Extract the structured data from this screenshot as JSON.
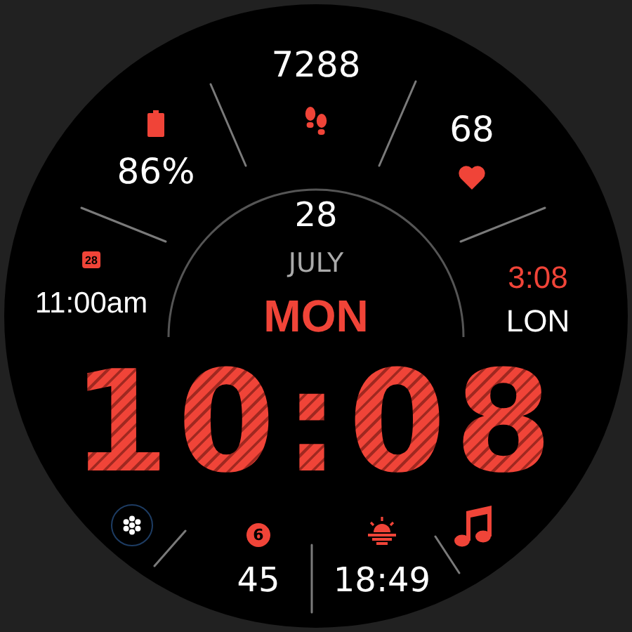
{
  "steps": {
    "value": "7288"
  },
  "battery": {
    "value": "86%"
  },
  "heart_rate": {
    "value": "68"
  },
  "date": {
    "day": "28",
    "month": "JULY",
    "weekday": "MON"
  },
  "event": {
    "icon_day": "28",
    "time": "11:00am"
  },
  "world_clock": {
    "time": "3:08",
    "city": "LON"
  },
  "time": "10:08",
  "notifications": {
    "badge": "6",
    "value": "45"
  },
  "sunset": {
    "time": "18:49"
  }
}
